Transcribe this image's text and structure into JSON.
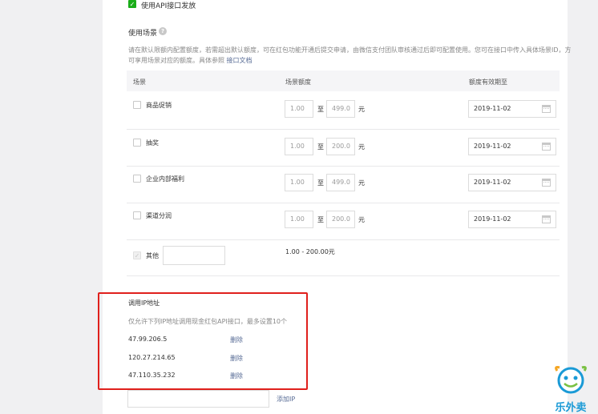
{
  "api_release": {
    "label": "使用API接口发放",
    "checked": true
  },
  "scene_section": {
    "title": "使用场景",
    "description": "请在默认限额内配置额度，若需超出默认额度，可在红包功能开通后提交申请，由微信支付团队审核通过后即可配置使用。您可在接口中传入具体场景ID，方可享用场景对应的额度。具体参照",
    "doc_link": "接口文档",
    "columns": [
      "场景",
      "场景额度",
      "额度有效期至"
    ],
    "range_sep": "至",
    "unit": "元",
    "rows": [
      {
        "name": "商品促销",
        "min": "1.00",
        "max": "499.0",
        "date": "2019-11-02"
      },
      {
        "name": "抽奖",
        "min": "1.00",
        "max": "200.0",
        "date": "2019-11-02"
      },
      {
        "name": "企业内部福利",
        "min": "1.00",
        "max": "499.0",
        "date": "2019-11-02"
      },
      {
        "name": "渠道分润",
        "min": "1.00",
        "max": "200.0",
        "date": "2019-11-02"
      }
    ],
    "other": {
      "name": "其他",
      "range_text": "1.00 - 200.00元"
    }
  },
  "ip_section": {
    "title": "调用IP地址",
    "hint": "仅允许下列IP地址调用现金红包API接口，最多设置10个",
    "delete_label": "删除",
    "ips": [
      "47.99.206.5",
      "120.27.214.65",
      "47.110.35.232"
    ],
    "add_label": "添加IP"
  },
  "watermark": {
    "text": "乐外卖",
    "color": "#1a9ad6"
  },
  "colors": {
    "accent_green": "#1aad19",
    "link_blue": "#576b95",
    "highlight_red": "#e0201c"
  }
}
